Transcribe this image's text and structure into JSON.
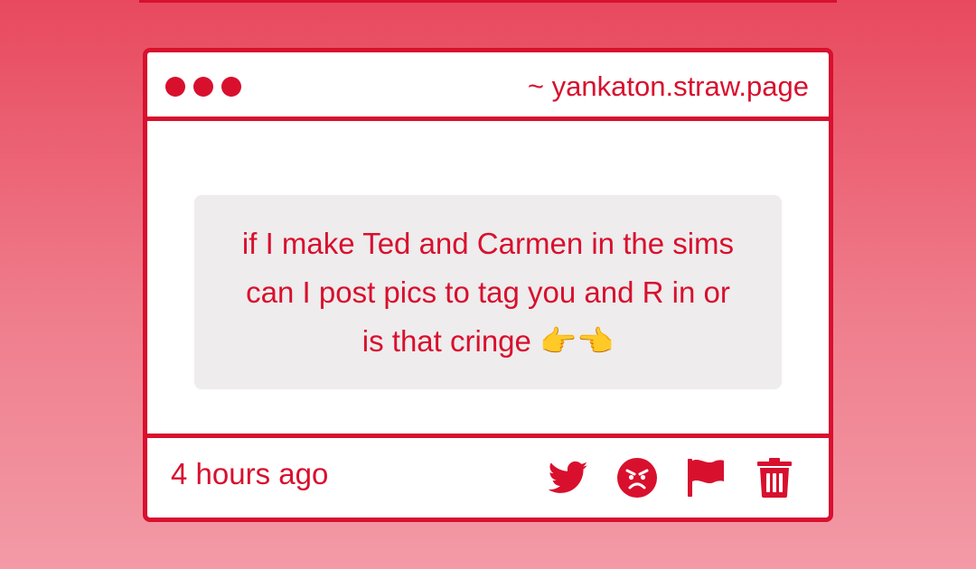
{
  "window": {
    "url": "~ yankaton.straw.page"
  },
  "message": {
    "text": "if I make Ted and Carmen in the sims can I post pics to tag you and R in or is that cringe 👉👈"
  },
  "footer": {
    "timestamp": "4 hours ago",
    "actions": [
      {
        "name": "twitter-icon",
        "label": "share-to-twitter"
      },
      {
        "name": "angry-face-icon",
        "label": "react-angry"
      },
      {
        "name": "flag-icon",
        "label": "report"
      },
      {
        "name": "trash-icon",
        "label": "delete"
      }
    ]
  },
  "colors": {
    "accent": "#d8102e",
    "background_top": "#e8495e",
    "background_bottom": "#f39aa6",
    "bubble": "#eeeced"
  }
}
